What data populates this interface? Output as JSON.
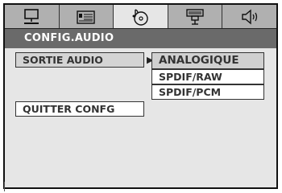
{
  "tabs": [
    {
      "icon": "monitor-icon",
      "active": false
    },
    {
      "icon": "speaker-panel-icon",
      "active": false
    },
    {
      "icon": "disc-music-icon",
      "active": true
    },
    {
      "icon": "video-projector-icon",
      "active": false
    },
    {
      "icon": "speaker-sound-icon",
      "active": false
    }
  ],
  "header": {
    "title": "CONFIG.AUDIO"
  },
  "menu": {
    "items": [
      {
        "label": "SORTIE AUDIO",
        "selected": true
      },
      {
        "label": "QUITTER CONFG",
        "selected": false
      }
    ]
  },
  "submenu": {
    "options": [
      {
        "label": "ANALOGIQUE",
        "selected": true
      },
      {
        "label": "SPDIF/RAW",
        "selected": false
      },
      {
        "label": "SPDIF/PCM",
        "selected": false
      }
    ]
  },
  "colors": {
    "background": "#e6e6e6",
    "tab_inactive": "#b0b0b0",
    "header": "#6a6a6a",
    "selected": "#d4d4d4"
  }
}
